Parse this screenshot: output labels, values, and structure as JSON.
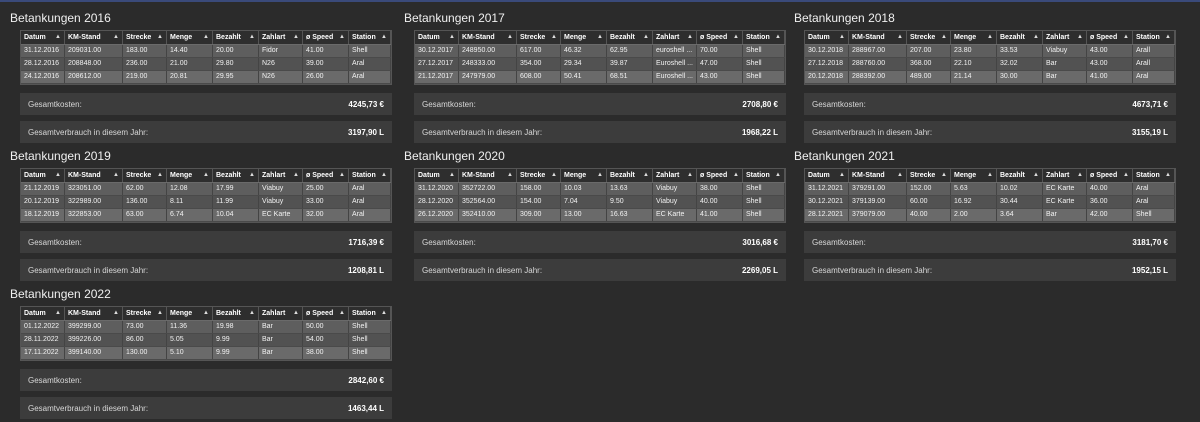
{
  "columns": [
    "Datum",
    "KM-Stand",
    "Strecke",
    "Menge",
    "Bezahlt",
    "Zahlart",
    "ø Speed",
    "Station"
  ],
  "labels": {
    "total_cost": "Gesamtkosten:",
    "total_usage": "Gesamtverbrauch in diesem Jahr:"
  },
  "panels": [
    {
      "title": "Betankungen 2016",
      "rows": [
        [
          "31.12.2016",
          "209031.00",
          "183.00",
          "14.40",
          "20.00",
          "Fidor",
          "41.00",
          "Shell"
        ],
        [
          "28.12.2016",
          "208848.00",
          "236.00",
          "21.00",
          "29.80",
          "N26",
          "39.00",
          "Aral"
        ],
        [
          "24.12.2016",
          "208612.00",
          "219.00",
          "20.81",
          "29.95",
          "N26",
          "26.00",
          "Aral"
        ]
      ],
      "cost": "4245,73 €",
      "usage": "3197,90 L"
    },
    {
      "title": "Betankungen 2017",
      "rows": [
        [
          "30.12.2017",
          "248950.00",
          "617.00",
          "46.32",
          "62.95",
          "euroshell ...",
          "70.00",
          "Shell"
        ],
        [
          "27.12.2017",
          "248333.00",
          "354.00",
          "29.34",
          "39.87",
          "Euroshell ...",
          "47.00",
          "Shell"
        ],
        [
          "21.12.2017",
          "247979.00",
          "608.00",
          "50.41",
          "68.51",
          "Euroshell ...",
          "43.00",
          "Shell"
        ]
      ],
      "cost": "2708,80 €",
      "usage": "1968,22 L"
    },
    {
      "title": "Betankungen 2018",
      "rows": [
        [
          "30.12.2018",
          "288967.00",
          "207.00",
          "23.80",
          "33.53",
          "Viabuy",
          "43.00",
          "Arall"
        ],
        [
          "27.12.2018",
          "288760.00",
          "368.00",
          "22.10",
          "32.02",
          "Bar",
          "43.00",
          "Arall"
        ],
        [
          "20.12.2018",
          "288392.00",
          "489.00",
          "21.14",
          "30.00",
          "Bar",
          "41.00",
          "Aral"
        ]
      ],
      "cost": "4673,71 €",
      "usage": "3155,19 L"
    },
    {
      "title": "Betankungen 2019",
      "rows": [
        [
          "21.12.2019",
          "323051.00",
          "62.00",
          "12.08",
          "17.99",
          "Viabuy",
          "25.00",
          "Aral"
        ],
        [
          "20.12.2019",
          "322989.00",
          "136.00",
          "8.11",
          "11.99",
          "Viabuy",
          "33.00",
          "Aral"
        ],
        [
          "18.12.2019",
          "322853.00",
          "63.00",
          "6.74",
          "10.04",
          "EC Karte",
          "32.00",
          "Aral"
        ]
      ],
      "cost": "1716,39 €",
      "usage": "1208,81 L"
    },
    {
      "title": "Betankungen 2020",
      "rows": [
        [
          "31.12.2020",
          "352722.00",
          "158.00",
          "10.03",
          "13.63",
          "Viabuy",
          "38.00",
          "Shell"
        ],
        [
          "28.12.2020",
          "352564.00",
          "154.00",
          "7.04",
          "9.50",
          "Viabuy",
          "40.00",
          "Shell"
        ],
        [
          "26.12.2020",
          "352410.00",
          "309.00",
          "13.00",
          "16.63",
          "EC Karte",
          "41.00",
          "Shell"
        ]
      ],
      "cost": "3016,68 €",
      "usage": "2269,05 L"
    },
    {
      "title": "Betankungen 2021",
      "rows": [
        [
          "31.12.2021",
          "379291.00",
          "152.00",
          "5.63",
          "10.02",
          "EC Karte",
          "40.00",
          "Aral"
        ],
        [
          "30.12.2021",
          "379139.00",
          "60.00",
          "16.92",
          "30.44",
          "EC Karte",
          "36.00",
          "Aral"
        ],
        [
          "28.12.2021",
          "379079.00",
          "40.00",
          "2.00",
          "3.64",
          "Bar",
          "42.00",
          "Shell"
        ]
      ],
      "cost": "3181,70 €",
      "usage": "1952,15 L"
    },
    {
      "title": "Betankungen 2022",
      "rows": [
        [
          "01.12.2022",
          "399299.00",
          "73.00",
          "11.36",
          "19.98",
          "Bar",
          "50.00",
          "Shell"
        ],
        [
          "28.11.2022",
          "399226.00",
          "86.00",
          "5.05",
          "9.99",
          "Bar",
          "54.00",
          "Shell"
        ],
        [
          "17.11.2022",
          "399140.00",
          "130.00",
          "5.10",
          "9.99",
          "Bar",
          "38.00",
          "Shell"
        ]
      ],
      "cost": "2842,60 €",
      "usage": "1463,44 L"
    }
  ]
}
